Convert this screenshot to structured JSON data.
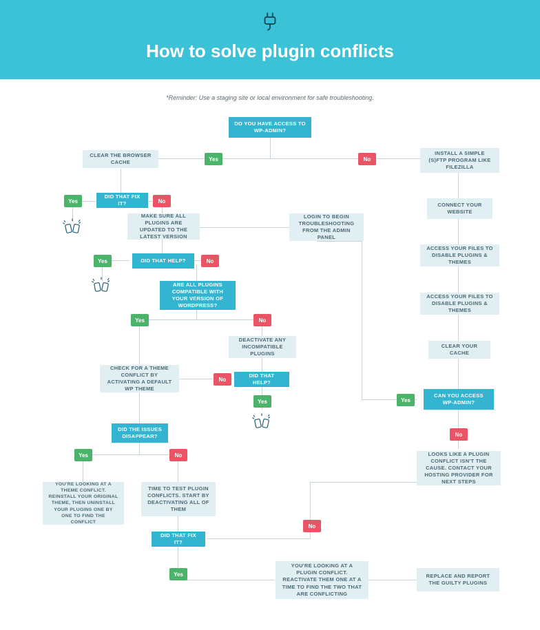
{
  "hero": {
    "title": "How to solve plugin conflicts"
  },
  "reminder": "*Reminder: Use a staging site or local environment for safe troubleshooting.",
  "yes": "Yes",
  "no": "No",
  "n": {
    "root": "DO YOU HAVE ACCESS TO WP-ADMIN?",
    "cache": "CLEAR THE BROWSER CACHE",
    "fix1": "DID THAT FIX IT?",
    "update": "MAKE SURE ALL PLUGINS ARE UPDATED TO THE LATEST VERSION",
    "help1": "DID THAT HELP?",
    "compat": "ARE ALL PLUGINS COMPATIBLE WITH YOUR VERSION OF WORDPRESS?",
    "deact": "DEACTIVATE ANY INCOMPATIBLE PLUGINS",
    "help2": "DID THAT HELP?",
    "theme": "CHECK FOR A THEME CONFLICT BY ACTIVATING A DEFAULT WP THEME",
    "issues": "DID THE ISSUES DISAPPEAR?",
    "resultT": "YOU'RE LOOKING AT A THEME CONFLICT. REINSTALL YOUR ORIGINAL THEME, THEN UNINSTALL YOUR PLUGINS ONE BY ONE TO FIND THE CONFLICT",
    "resultP": "TIME TO TEST PLUGIN CONFLICTS. START BY DEACTIVATING ALL OF THEM",
    "fix2": "DID THAT FIX IT?",
    "reactP": "YOU'RE LOOKING AT A PLUGIN CONFLICT. REACTIVATE THEM ONE AT A TIME TO FIND THE TWO THAT ARE CONFLICTING",
    "replace": "REPLACE AND REPORT THE GUILTY PLUGINS",
    "login": "LOGIN TO BEGIN TROUBLESHOOTING FROM THE ADMIN PANEL",
    "ftp": "INSTALL A SIMPLE (S)FTP PROGRAM LIKE FILEZILLA",
    "connect": "CONNECT YOUR WEBSITE",
    "disable1": "ACCESS YOUR FILES TO DISABLE PLUGINS & THEMES",
    "disable2": "ACCESS YOUR FILES TO DISABLE PLUGINS & THEMES",
    "clear": "CLEAR YOUR CACHE",
    "access": "CAN YOU ACCESS WP-ADMIN?",
    "hosting": "LOOKS LIKE A PLUGIN CONFLICT ISN'T THE CAUSE. CONTACT YOUR HOSTING PROVIDER FOR NEXT STEPS"
  }
}
